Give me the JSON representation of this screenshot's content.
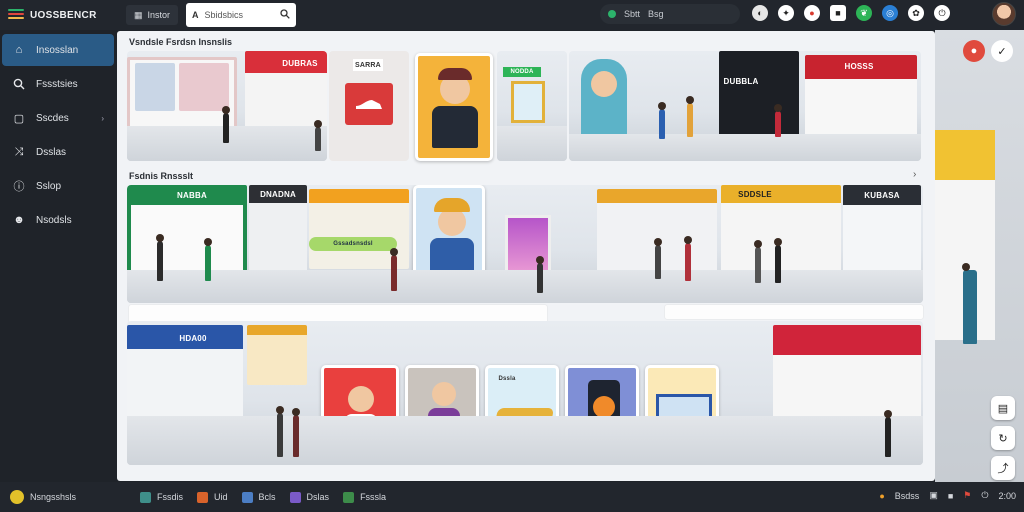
{
  "app": {
    "title": "UOSSBENCR"
  },
  "topbar": {
    "tab_label": "Instor",
    "search_placeholder": "Sbidsbics",
    "status_text": "Sbtt",
    "status_value": "Bsg"
  },
  "sidebar": {
    "items": [
      {
        "label": "Insosslan",
        "icon": "home-icon",
        "active": true
      },
      {
        "label": "Fssstsies",
        "icon": "search-icon"
      },
      {
        "label": "Sscdes",
        "icon": "square-icon",
        "has_chevron": true
      },
      {
        "label": "Dsslas",
        "icon": "shuffle-icon"
      },
      {
        "label": "Sslop",
        "icon": "info-icon"
      },
      {
        "label": "Nsodsls",
        "icon": "face-icon"
      }
    ]
  },
  "main": {
    "row1_label": "Vsndsle Fsrdsn Insnslis",
    "row2_label": "Fsdnis Rnssslt",
    "row2_chevron": "›",
    "signs": {
      "s1": "DUBRAS",
      "s2": "SARRA",
      "s3": "NODDA",
      "s4": "DUBBLA",
      "s5": "HOSSS",
      "s6": "NABBA",
      "s7": "DNADNA",
      "s8": "KUBASA",
      "s9": "HDA00",
      "s10": "SDDSLE",
      "kiosk": "Gssadsnsdsl",
      "card_tag": "Dssla"
    }
  },
  "bottombar": {
    "left_label": "Nsngsshsls",
    "items": [
      {
        "label": "Fssdis",
        "color": "#3f8f8a"
      },
      {
        "label": "Uid",
        "color": "#d9632b"
      },
      {
        "label": "Bcls",
        "color": "#4c7ec4"
      },
      {
        "label": "Dslas",
        "color": "#7a5ac8"
      },
      {
        "label": "Fsssla",
        "color": "#3d8c4a"
      }
    ],
    "right_label": "Bsdss",
    "time": "2:00"
  },
  "colors": {
    "accent": "#2a5b86",
    "topbar_bg": "#22262d",
    "main_bg": "#f1f3f6"
  }
}
